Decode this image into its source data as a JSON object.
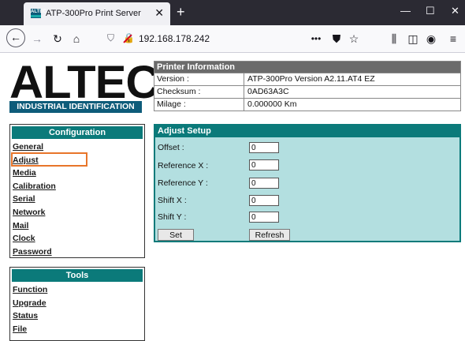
{
  "browser": {
    "tab_title": "ATP-300Pro Print Server",
    "favicon_text": "ALTEC",
    "url": "192.168.178.242"
  },
  "logo": {
    "name": "ALTEC",
    "subtitle": "INDUSTRIAL IDENTIFICATION"
  },
  "configuration": {
    "title": "Configuration",
    "items": [
      "General",
      "Adjust",
      "Media",
      "Calibration",
      "Serial",
      "Network",
      "Mail",
      "Clock",
      "Password"
    ],
    "selected": "Adjust"
  },
  "tools": {
    "title": "Tools",
    "items": [
      "Function",
      "Upgrade",
      "Status",
      "File"
    ]
  },
  "printer_info": {
    "title": "Printer Information",
    "rows": [
      {
        "label": "Version :",
        "value": "ATP-300Pro Version A2.11.AT4 EZ"
      },
      {
        "label": "Checksum :",
        "value": "0AD63A3C"
      },
      {
        "label": "Milage :",
        "value": "0.000000 Km"
      }
    ]
  },
  "adjust_setup": {
    "title": "Adjust Setup",
    "fields": [
      {
        "label": "Offset :",
        "value": "0"
      },
      {
        "label": "Reference X :",
        "value": "0"
      },
      {
        "label": "Reference Y :",
        "value": "0"
      },
      {
        "label": "Shift X :",
        "value": "0"
      },
      {
        "label": "Shift Y :",
        "value": "0"
      }
    ],
    "set_label": "Set",
    "refresh_label": "Refresh"
  },
  "colors": {
    "accent": "#0b7a7a",
    "panel_bg": "#b3dfe0",
    "info_header": "#6b6b6b",
    "selection_outline": "#e8752a"
  }
}
